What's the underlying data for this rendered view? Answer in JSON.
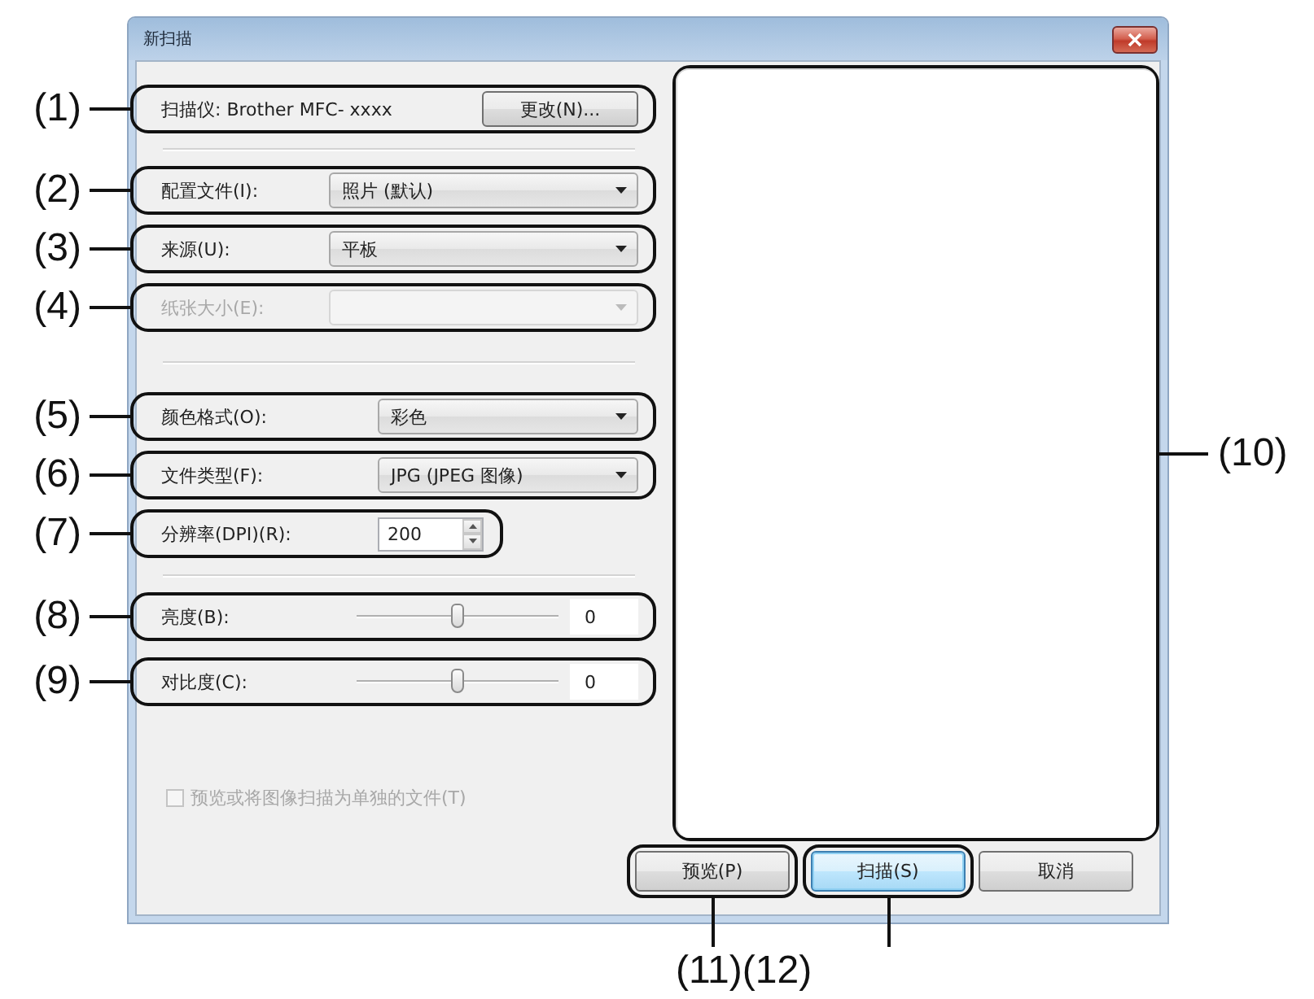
{
  "window": {
    "title": "新扫描"
  },
  "scanner": {
    "label": "扫描仪: Brother MFC- xxxx",
    "button": "更改(N)...",
    "callout": "(1)"
  },
  "sections": [
    {
      "rows": [
        {
          "kind": "dropdown",
          "label": "配置文件(I):",
          "value": "照片 (默认)",
          "disabled": false,
          "callout": "(2)"
        },
        {
          "kind": "dropdown",
          "label": "来源(U):",
          "value": "平板",
          "disabled": false,
          "callout": "(3)"
        },
        {
          "kind": "dropdown",
          "label": "纸张大小(E):",
          "disabled": true,
          "callout": "(4)"
        }
      ]
    },
    {
      "rows": [
        {
          "kind": "dropdown",
          "label": "颜色格式(O):",
          "value": "彩色",
          "disabled": false,
          "callout": "(5)"
        },
        {
          "kind": "dropdown",
          "label": "文件类型(F):",
          "value": "JPG (JPEG 图像)",
          "disabled": false,
          "callout": "(6)"
        },
        {
          "kind": "spin",
          "label": "分辨率(DPI)(R):",
          "value": "200",
          "disabled": false,
          "callout": "(7)"
        }
      ]
    },
    {
      "rows": [
        {
          "kind": "slider",
          "label": "亮度(B):",
          "level": 0.5,
          "reading": "0",
          "disabled": false,
          "callout": "(8)"
        },
        {
          "kind": "slider",
          "label": "对比度(C):",
          "level": 0.5,
          "reading": "0",
          "disabled": false,
          "callout": "(9)"
        }
      ]
    }
  ],
  "checkbox": {
    "label": "预览或将图像扫描为单独的文件(T)",
    "checked": false,
    "disabled": true
  },
  "preview": {
    "callout": "(10)"
  },
  "buttons": [
    {
      "label": "预览(P)",
      "default": false,
      "callout": "(11)"
    },
    {
      "label": "扫描(S)",
      "default": true,
      "callout": "(12)"
    },
    {
      "label": "取消",
      "default": false
    }
  ]
}
